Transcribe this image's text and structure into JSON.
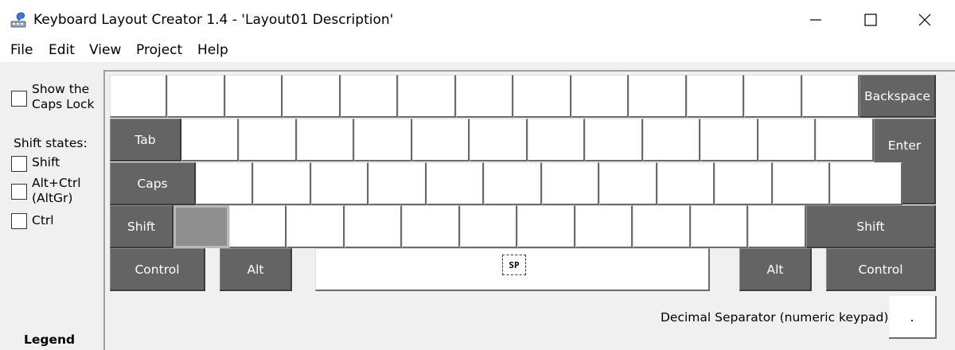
{
  "window": {
    "title": "Keyboard Layout Creator 1.4 - 'Layout01 Description'",
    "minimize_glyph": "—",
    "maximize_glyph": "☐",
    "close_glyph": "✕"
  },
  "menu": [
    "File",
    "Edit",
    "View",
    "Project",
    "Help"
  ],
  "sidebar": {
    "caps_lock_label": "Show the\nCaps Lock",
    "shift_states_title": "Shift states:",
    "shift_label": "Shift",
    "altgr_label": "Alt+Ctrl\n(AltGr)",
    "ctrl_label": "Ctrl",
    "legend_label": "Legend"
  },
  "keyboard": {
    "backspace": "Backspace",
    "tab": "Tab",
    "enter": "Enter",
    "caps": "Caps",
    "shift_left": "Shift",
    "shift_right": "Shift",
    "control_left": "Control",
    "alt_left": "Alt",
    "alt_right": "Alt",
    "control_right": "Control",
    "space_label": "SP",
    "decimal_separator_label": "Decimal Separator (numeric keypad)",
    "decimal_separator_value": "."
  },
  "colors": {
    "special_key": "#646464",
    "normal_key": "#ffffff",
    "selected_key": "#8f8f8f"
  }
}
